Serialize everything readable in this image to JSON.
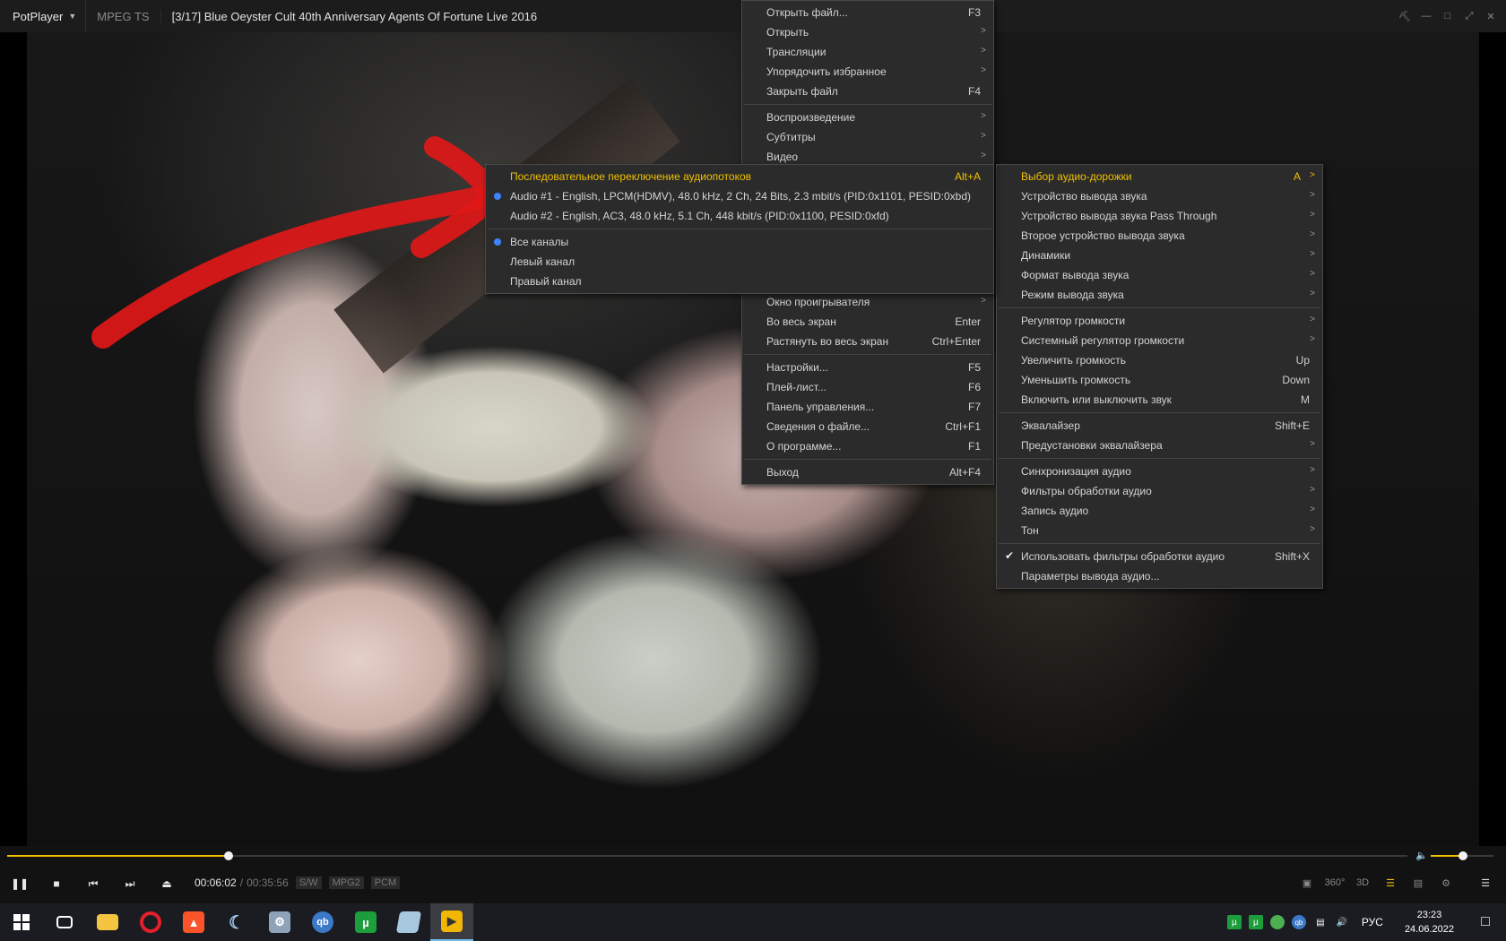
{
  "titlebar": {
    "app_name": "PotPlayer",
    "format": "MPEG TS",
    "title": "[3/17] Blue Oeyster Cult 40th Anniversary Agents Of Fortune Live 2016"
  },
  "main_menu": {
    "items": [
      {
        "label": "Открыть файл...",
        "shortcut": "F3"
      },
      {
        "label": "Открыть",
        "shortcut": ""
      },
      {
        "label": "Трансляции",
        "shortcut": ""
      },
      {
        "label": "Упорядочить избранное",
        "shortcut": ""
      },
      {
        "label": "Закрыть файл",
        "shortcut": "F4"
      },
      {
        "label": "Воспроизведение",
        "shortcut": ""
      },
      {
        "label": "Субтитры",
        "shortcut": ""
      },
      {
        "label": "Видео",
        "shortcut": ""
      },
      {
        "label": "Окно проигрывателя",
        "shortcut": ""
      },
      {
        "label": "Во весь экран",
        "shortcut": "Enter"
      },
      {
        "label": "Растянуть во весь экран",
        "shortcut": "Ctrl+Enter"
      },
      {
        "label": "Настройки...",
        "shortcut": "F5"
      },
      {
        "label": "Плей-лист...",
        "shortcut": "F6"
      },
      {
        "label": "Панель управления...",
        "shortcut": "F7"
      },
      {
        "label": "Сведения о файле...",
        "shortcut": "Ctrl+F1"
      },
      {
        "label": "О программе...",
        "shortcut": "F1"
      },
      {
        "label": "Выход",
        "shortcut": "Alt+F4"
      }
    ]
  },
  "audio_menu": {
    "items": [
      {
        "label": "Выбор аудио-дорожки",
        "shortcut": "A"
      },
      {
        "label": "Устройство вывода звука",
        "shortcut": ""
      },
      {
        "label": "Устройство вывода звука Pass Through",
        "shortcut": ""
      },
      {
        "label": "Второе устройство вывода звука",
        "shortcut": ""
      },
      {
        "label": "Динамики",
        "shortcut": ""
      },
      {
        "label": "Формат вывода звука",
        "shortcut": ""
      },
      {
        "label": "Режим вывода звука",
        "shortcut": ""
      },
      {
        "label": "Регулятор громкости",
        "shortcut": ""
      },
      {
        "label": "Системный регулятор громкости",
        "shortcut": ""
      },
      {
        "label": "Увеличить громкость",
        "shortcut": "Up"
      },
      {
        "label": "Уменьшить громкость",
        "shortcut": "Down"
      },
      {
        "label": "Включить или выключить звук",
        "shortcut": "M"
      },
      {
        "label": "Эквалайзер",
        "shortcut": "Shift+E"
      },
      {
        "label": "Предустановки эквалайзера",
        "shortcut": ""
      },
      {
        "label": "Синхронизация аудио",
        "shortcut": ""
      },
      {
        "label": "Фильтры обработки аудио",
        "shortcut": ""
      },
      {
        "label": "Запись аудио",
        "shortcut": ""
      },
      {
        "label": "Тон",
        "shortcut": ""
      },
      {
        "label": "Использовать фильтры обработки аудио",
        "shortcut": "Shift+X"
      },
      {
        "label": "Параметры вывода аудио...",
        "shortcut": ""
      }
    ]
  },
  "track_menu": {
    "items": [
      {
        "label": "Последовательное переключение аудиопотоков",
        "shortcut": "Alt+A"
      },
      {
        "label": "Audio #1 - English, LPCM(HDMV), 48.0 kHz, 2 Ch, 24 Bits, 2.3 mbit/s (PID:0x1101, PESID:0xbd)",
        "shortcut": ""
      },
      {
        "label": "Audio #2 - English, AC3, 48.0 kHz, 5.1 Ch, 448 kbit/s (PID:0x1100, PESID:0xfd)",
        "shortcut": ""
      },
      {
        "label": "Все каналы",
        "shortcut": ""
      },
      {
        "label": "Левый канал",
        "shortcut": ""
      },
      {
        "label": "Правый канал",
        "shortcut": ""
      }
    ]
  },
  "controls": {
    "time_current": "00:06:02",
    "time_sep": "/",
    "time_total": "00:35:56",
    "tag_sw": "S/W",
    "tag_video": "MPG2",
    "tag_audio": "PCM",
    "seek_progress": 0.158,
    "volume_level": 0.52,
    "btn_360": "360°",
    "btn_3d": "3D"
  },
  "taskbar": {
    "lang": "РУС",
    "time": "23:23",
    "date": "24.06.2022"
  },
  "colors": {
    "accent": "#f0c000",
    "selected_dot": "#3e84ff"
  }
}
